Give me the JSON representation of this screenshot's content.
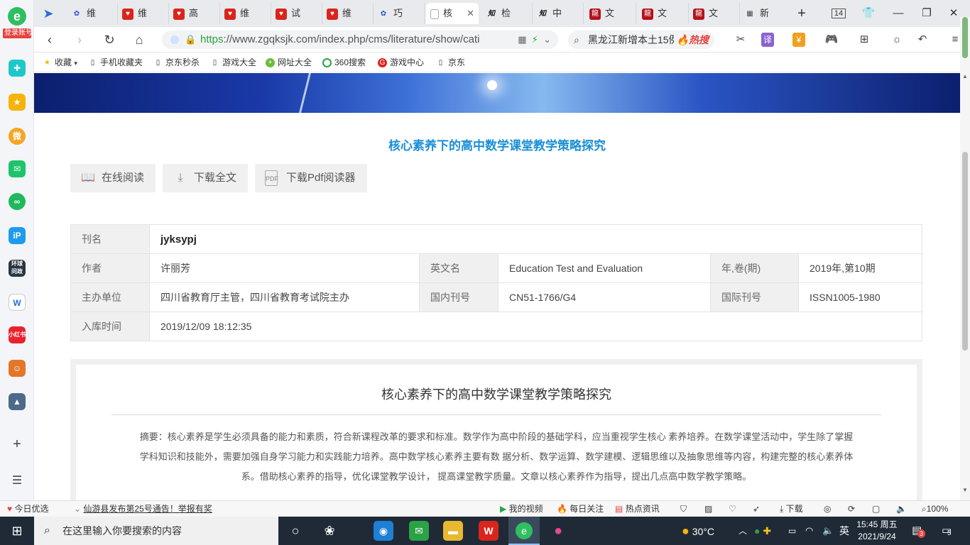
{
  "sidebar": {
    "login_badge": "登录账号",
    "items": [
      "health",
      "favorite",
      "weibo",
      "mail",
      "link",
      "ip",
      "news",
      "doc",
      "shop",
      "game1",
      "game2",
      "add",
      "menu"
    ]
  },
  "tabs": [
    {
      "label": "维",
      "icon": "paw-icon"
    },
    {
      "label": "维",
      "icon": "red-shield-icon"
    },
    {
      "label": "高",
      "icon": "red-shield-icon"
    },
    {
      "label": "维",
      "icon": "red-shield-icon"
    },
    {
      "label": "试",
      "icon": "red-shield-icon"
    },
    {
      "label": "维",
      "icon": "red-shield-icon"
    },
    {
      "label": "巧",
      "icon": "paw-icon"
    },
    {
      "label": "核",
      "icon": "page-icon",
      "active": true
    },
    {
      "label": "检",
      "icon": "zhi-icon"
    },
    {
      "label": "中",
      "icon": "zhi-icon"
    },
    {
      "label": "文",
      "icon": "long-icon"
    },
    {
      "label": "文",
      "icon": "long-icon"
    },
    {
      "label": "文",
      "icon": "long-icon"
    },
    {
      "label": "新",
      "icon": "grid-icon"
    }
  ],
  "tab_count": "14",
  "address": {
    "scheme": "https",
    "rest": "://www.zgqksjk.com/index.php/cms/literature/show/cati"
  },
  "search": {
    "query": "黑龙江新增本土15例",
    "hot_label": "热搜"
  },
  "bookmarks": [
    "收藏",
    "手机收藏夹",
    "京东秒杀",
    "游戏大全",
    "网址大全",
    "360搜索",
    "游戏中心",
    "京东"
  ],
  "article": {
    "title": "核心素养下的高中数学课堂教学策略探究",
    "buttons": {
      "read_online": "在线阅读",
      "download_full": "下载全文",
      "download_pdf_reader": "下载Pdf阅读器"
    },
    "info": {
      "journal_label": "刊名",
      "journal": "jyksypj",
      "author_label": "作者",
      "author": "许丽芳",
      "en_name_label": "英文名",
      "en_name": "Education Test and Evaluation",
      "year_label": "年,卷(期)",
      "year": "2019年,第10期",
      "host_label": "主办单位",
      "host": "四川省教育厅主管，四川省教育考试院主办",
      "cn_label": "国内刊号",
      "cn": "CN51-1766/G4",
      "issn_label": "国际刊号",
      "issn": "ISSN1005-1980",
      "date_label": "入库时间",
      "date": "2019/12/09 18:12:35"
    },
    "abstract_title": "核心素养下的高中数学课堂教学策略探究",
    "abstract_lines": [
      "摘要：核心素养是学生必须具备的能力和素质，符合新课程改革的要求和标准。数学作为高中阶段的基础学科，应当重视学生核心 素养培养。在数学课堂活动中，学生除了掌握",
      "学科知识和技能外，需要加强自身学习能力和实践能力培养。高中数学核心素养主要有数 据分析、数学运算、数学建模、逻辑思维以及抽象思维等内容，构建完整的核心素养体",
      "系。借助核心素养的指导，优化课堂教学设计， 提高课堂教学质量。文章以核心素养作为指导，提出几点高中数学教学策略。"
    ]
  },
  "statusbar": {
    "today": "今日优选",
    "news": "仙游县发布第25号通告！举报有奖",
    "video": "我的视频",
    "follow": "每日关注",
    "hot_news": "热点资讯",
    "download": "下载",
    "zoom": "100%"
  },
  "taskbar": {
    "search_placeholder": "在这里输入你要搜索的内容",
    "temp": "30°C",
    "ime": "英",
    "time": "15:45 周五",
    "date": "2021/9/24",
    "notif_count": "3",
    "action_count": "5"
  }
}
